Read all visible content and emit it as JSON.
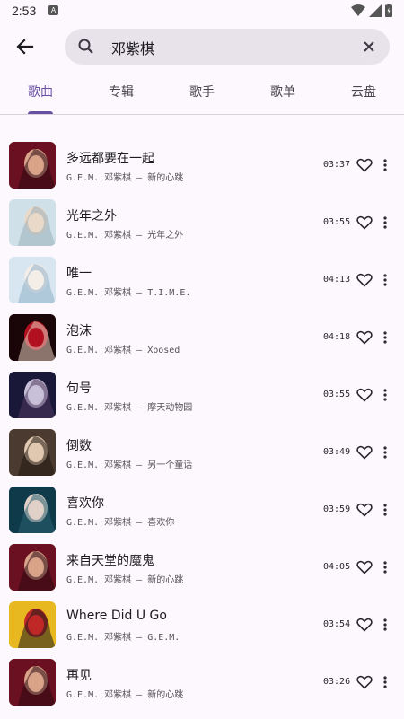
{
  "status": {
    "time": "2:53",
    "notif": "A"
  },
  "search": {
    "query": "邓紫棋"
  },
  "tabs": [
    {
      "label": "歌曲",
      "active": true
    },
    {
      "label": "专辑",
      "active": false
    },
    {
      "label": "歌手",
      "active": false
    },
    {
      "label": "歌单",
      "active": false
    },
    {
      "label": "云盘",
      "active": false
    }
  ],
  "songs": [
    {
      "title": "多远都要在一起",
      "subtitle": "G.E.M. 邓紫棋 – 新的心跳",
      "duration": "03:37"
    },
    {
      "title": "光年之外",
      "subtitle": "G.E.M. 邓紫棋 – 光年之外",
      "duration": "03:55"
    },
    {
      "title": "唯一",
      "subtitle": "G.E.M. 邓紫棋 – T.I.M.E.",
      "duration": "04:13"
    },
    {
      "title": "泡沫",
      "subtitle": "G.E.M. 邓紫棋 – Xposed",
      "duration": "04:18"
    },
    {
      "title": "句号",
      "subtitle": "G.E.M. 邓紫棋 – 摩天动物园",
      "duration": "03:55"
    },
    {
      "title": "倒数",
      "subtitle": "G.E.M. 邓紫棋 – 另一个童话",
      "duration": "03:49"
    },
    {
      "title": "喜欢你",
      "subtitle": "G.E.M. 邓紫棋 – 喜欢你",
      "duration": "03:59"
    },
    {
      "title": "来自天堂的魔鬼",
      "subtitle": "G.E.M. 邓紫棋 – 新的心跳",
      "duration": "04:05"
    },
    {
      "title": "Where Did U Go",
      "subtitle": "G.E.M. 邓紫棋 – G.E.M.",
      "duration": "03:54"
    },
    {
      "title": "再见",
      "subtitle": "G.E.M. 邓紫棋 – 新的心跳",
      "duration": "03:26"
    }
  ],
  "colors": {
    "accent": "#6750a4",
    "background": "#fdf8fd",
    "search_bg": "#e8e3ea"
  }
}
